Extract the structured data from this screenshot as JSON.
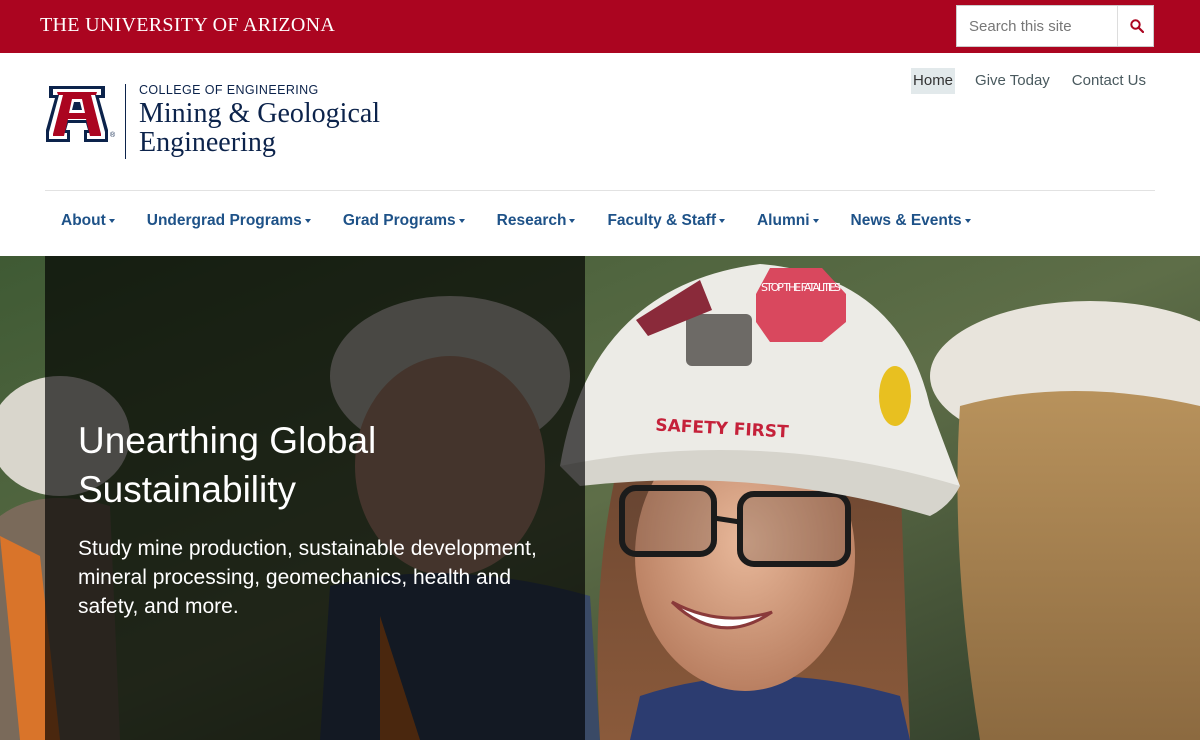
{
  "topbar": {
    "wordmark": "THE UNIVERSITY OF ARIZONA",
    "search_placeholder": "Search this site"
  },
  "header": {
    "college": "COLLEGE OF ENGINEERING",
    "dept_line1": "Mining & Geological",
    "dept_line2": "Engineering",
    "utility_links": [
      "Home",
      "Give Today",
      "Contact Us"
    ]
  },
  "nav": {
    "items": [
      "About",
      "Undergrad Programs",
      "Grad Programs",
      "Research",
      "Faculty & Staff",
      "Alumni",
      "News & Events"
    ]
  },
  "hero": {
    "title": "Unearthing Global Sustainability",
    "subtitle": "Study mine production, sustainable development, mineral processing, geomechanics, health and safety, and more.",
    "helmet_sticker": "STOP THE FATALITIES",
    "helmet_band": "SAFETY FIRST"
  },
  "colors": {
    "brand_red": "#AB0520",
    "brand_navy": "#0C234B",
    "nav_blue": "#1E5288"
  },
  "icons": [
    "search-icon",
    "university-a-logo",
    "caret-down-icon"
  ]
}
